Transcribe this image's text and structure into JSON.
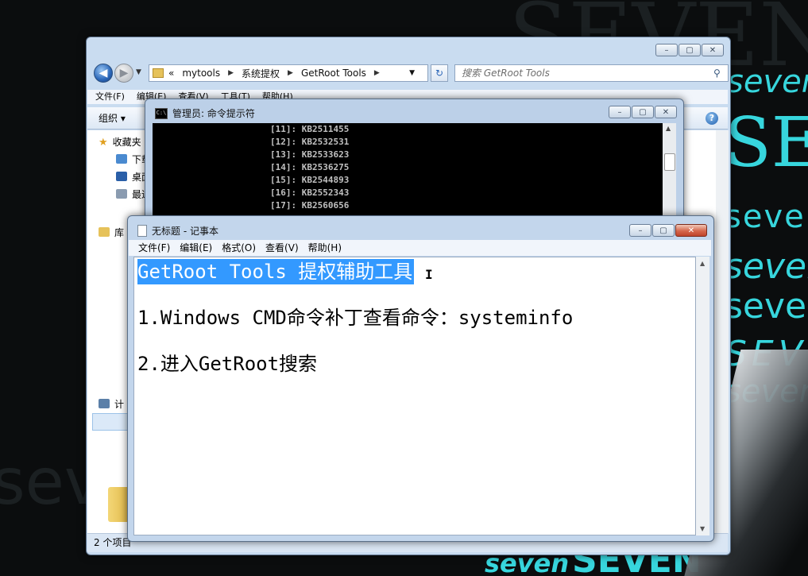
{
  "wallpaper": {
    "texts": [
      "SEVEN",
      "seven",
      "seven",
      "SEVEN",
      "seven"
    ]
  },
  "explorer": {
    "caption_buttons": {
      "min": "–",
      "max": "▢",
      "close": "✕"
    },
    "address": {
      "overflow": "«",
      "crumbs": [
        "mytools",
        "系统提权",
        "GetRoot Tools"
      ]
    },
    "search_placeholder": "搜索 GetRoot Tools",
    "menu": [
      "文件(F)",
      "编辑(E)",
      "查看(V)",
      "工具(T)",
      "帮助(H)"
    ],
    "toolbar": {
      "organize": "组织 ▾",
      "help": "?"
    },
    "nav": [
      {
        "label": "收藏夹",
        "icon": "star-icon"
      },
      {
        "label": "下载",
        "icon": "download-icon"
      },
      {
        "label": "桌面",
        "icon": "desktop-icon"
      },
      {
        "label": "最近",
        "icon": "recent-icon"
      },
      {
        "label": "库",
        "icon": "library-icon"
      },
      {
        "label": "计",
        "icon": "computer-icon"
      }
    ],
    "status": "2 个项目"
  },
  "cmd": {
    "title": "管理员: 命令提示符",
    "icon_text": "C:\\",
    "lines": [
      "[11]: KB2511455",
      "[12]: KB2532531",
      "[13]: KB2533623",
      "[14]: KB2536275",
      "[15]: KB2544893",
      "[16]: KB2552343",
      "[17]: KB2560656"
    ]
  },
  "notepad": {
    "title": "无标题 - 记事本",
    "menu": [
      "文件(F)",
      "编辑(E)",
      "格式(O)",
      "查看(V)",
      "帮助(H)"
    ],
    "lines": [
      "GetRoot Tools 提权辅助工具",
      "1.Windows CMD命令补丁查看命令：systeminfo",
      "2.进入GetRoot搜索"
    ],
    "cursor": "I"
  },
  "colors": {
    "selection": "#3399ff",
    "wallpaper_accent": "#37d6dd",
    "close_button": "#c0432a"
  }
}
